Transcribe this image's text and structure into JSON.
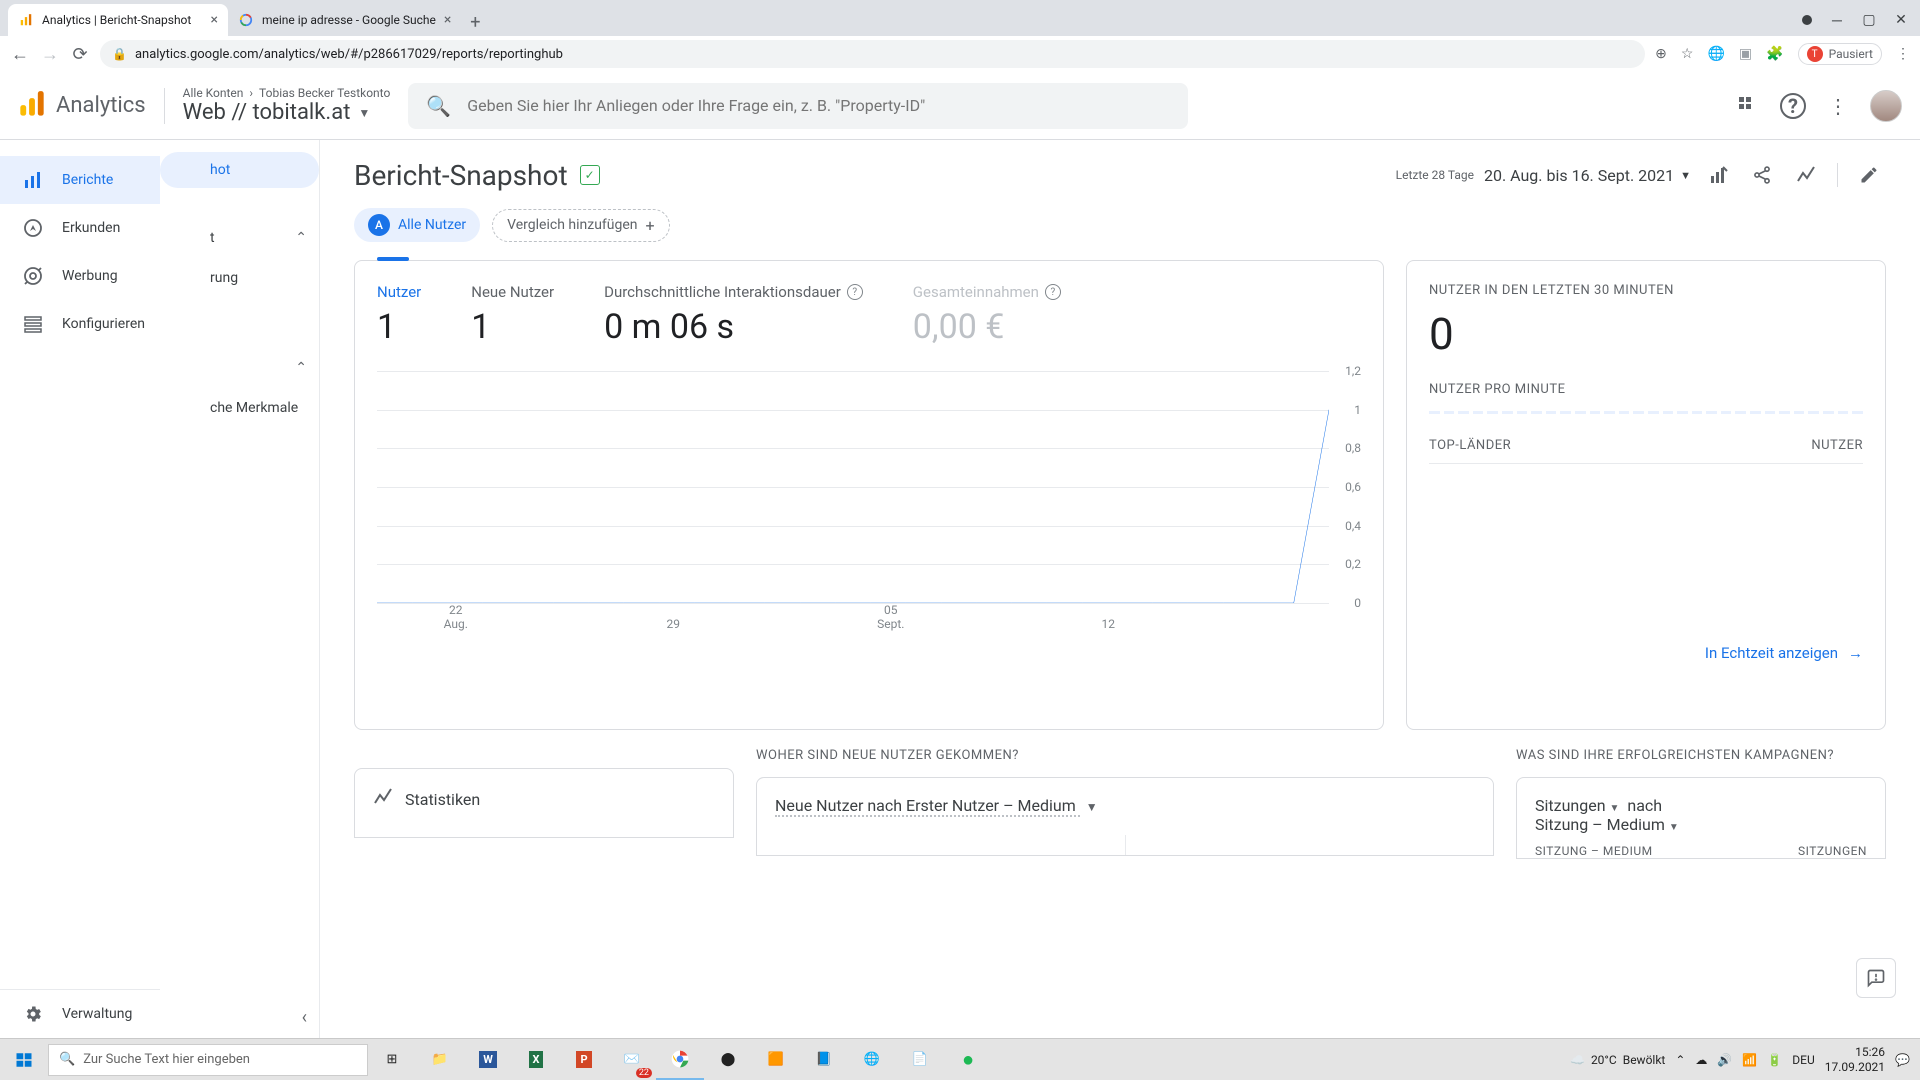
{
  "browser": {
    "tabs": [
      {
        "title": "Analytics | Bericht-Snapshot"
      },
      {
        "title": "meine ip adresse - Google Suche"
      }
    ],
    "url": "analytics.google.com/analytics/web/#/p286617029/reports/reportinghub",
    "paused_label": "Pausiert",
    "avatar_letter": "T"
  },
  "header": {
    "product": "Analytics",
    "breadcrumb_all": "Alle Konten",
    "breadcrumb_account": "Tobias Becker Testkonto",
    "property": "Web // tobitalk.at",
    "search_placeholder": "Geben Sie hier Ihr Anliegen oder Ihre Frage ein, z. B. \"Property-ID\""
  },
  "nav": {
    "items": [
      {
        "label": "Berichte",
        "icon": "bar-chart"
      },
      {
        "label": "Erkunden",
        "icon": "explore"
      },
      {
        "label": "Werbung",
        "icon": "ads"
      },
      {
        "label": "Konfigurieren",
        "icon": "config"
      }
    ],
    "bottom": {
      "label": "Verwaltung"
    }
  },
  "subpanel": {
    "pill": "hot",
    "line1": "t",
    "line2": "rung",
    "line3": "che Merkmale"
  },
  "report": {
    "title": "Bericht-Snapshot",
    "date_scope": "Letzte 28 Tage",
    "date_range": "20. Aug. bis 16. Sept. 2021",
    "chips": {
      "all_users": "Alle Nutzer",
      "all_users_badge": "A",
      "compare": "Vergleich hinzufügen"
    }
  },
  "metrics": [
    {
      "label": "Nutzer",
      "value": "1",
      "state": "active"
    },
    {
      "label": "Neue Nutzer",
      "value": "1",
      "state": "normal"
    },
    {
      "label": "Durchschnittliche Interaktionsdauer",
      "value": "0 m 06 s",
      "state": "normal",
      "help": true
    },
    {
      "label": "Gesamteinnahmen",
      "value": "0,00 €",
      "state": "dim",
      "help": true
    }
  ],
  "chart_data": {
    "type": "line",
    "xlabel": "",
    "ylabel": "",
    "ylim": [
      0,
      1.2
    ],
    "y_ticks": [
      "1,2",
      "1",
      "0,8",
      "0,6",
      "0,4",
      "0,2",
      "0"
    ],
    "x_ticks": [
      {
        "top": "22",
        "sub": "Aug."
      },
      {
        "top": "29",
        "sub": ""
      },
      {
        "top": "05",
        "sub": "Sept."
      },
      {
        "top": "12",
        "sub": ""
      }
    ],
    "series": [
      {
        "name": "Nutzer",
        "x": [
          "20.Aug",
          "21",
          "22",
          "23",
          "24",
          "25",
          "26",
          "27",
          "28",
          "29",
          "30",
          "31",
          "01.Sep",
          "02",
          "03",
          "04",
          "05",
          "06",
          "07",
          "08",
          "09",
          "10",
          "11",
          "12",
          "13",
          "14",
          "15",
          "16"
        ],
        "values": [
          0,
          0,
          0,
          0,
          0,
          0,
          0,
          0,
          0,
          0,
          0,
          0,
          0,
          0,
          0,
          0,
          0,
          0,
          0,
          0,
          0,
          0,
          0,
          0,
          0,
          0,
          0,
          1
        ]
      }
    ]
  },
  "realtime": {
    "title": "NUTZER IN DEN LETZTEN 30 MINUTEN",
    "value": "0",
    "sub": "NUTZER PRO MINUTE",
    "col1": "TOP-LÄNDER",
    "col2": "NUTZER",
    "link": "In Echtzeit anzeigen"
  },
  "lower": {
    "where_title": "WOHER SIND NEUE NUTZER GEKOMMEN?",
    "stats_title": "Statistiken",
    "new_users_by": "Neue Nutzer nach Erster Nutzer – Medium",
    "camp_title": "WAS SIND IHRE ERFOLGREICHSTEN KAMPAGNEN?",
    "camp_line1a": "Sitzungen",
    "camp_line1b": "nach",
    "camp_line2": "Sitzung – Medium",
    "camp_col1": "SITZUNG – MEDIUM",
    "camp_col2": "SITZUNGEN"
  },
  "taskbar": {
    "search_placeholder": "Zur Suche Text hier eingeben",
    "weather_temp": "20°C",
    "weather_text": "Bewölkt",
    "lang": "DEU",
    "time": "15:26",
    "date": "17.09.2021"
  }
}
